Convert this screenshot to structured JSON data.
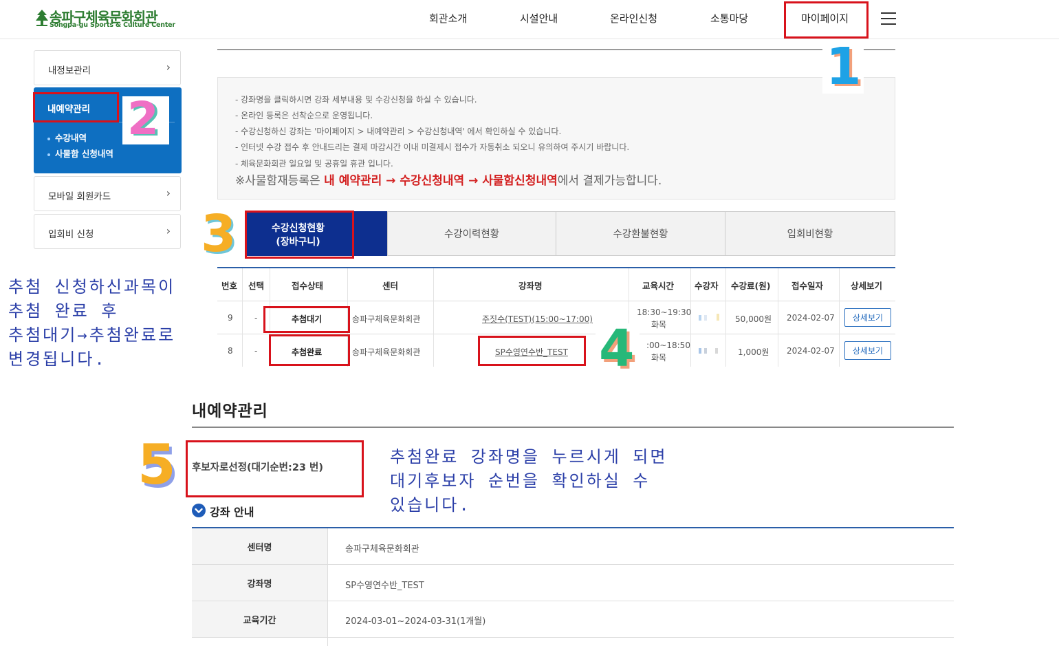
{
  "header": {
    "logo_kr": "송파구체육문화회관",
    "logo_en": "Songpa-gu Sports & Culture Center",
    "nav": [
      "회관소개",
      "시설안내",
      "온라인신청",
      "소통마당",
      "마이페이지"
    ]
  },
  "sidebar": {
    "items": [
      {
        "label": "내정보관리"
      },
      {
        "label": "내예약관리",
        "active": true,
        "subitems": [
          "수강내역",
          "사물함 신청내역"
        ]
      },
      {
        "label": "모바일 회원카드"
      },
      {
        "label": "입회비 신청"
      }
    ]
  },
  "notice": {
    "lines": [
      "- 강좌명을 클릭하시면 강좌 세부내용 및 수강신청을 하실 수 있습니다.",
      "- 온라인 등록은 선착순으로 운영됩니다.",
      "- 수강신청하신 강좌는 '마이페이지 > 내예약관리 > 수강신청내역' 에서 확인하실 수 있습니다.",
      "- 인터넷 수강 접수 후 안내드리는 결제 마감시간 이내 미결제시 접수가 자동취소 되오니 유의하여 주시기 바랍니다.",
      "- 체육문화회관 일요일 및 공휴일 휴관 입니다."
    ],
    "final_prefix": "※사물함재등록은 ",
    "final_red": "내 예약관리 → 수강신청내역 → 사물함신청내역",
    "final_suffix": "에서 결제가능합니다."
  },
  "tabs": {
    "active_line1": "수강신청현황",
    "active_line2": "(장바구니)",
    "others": [
      "수강이력현황",
      "수강환불현황",
      "입회비현황"
    ]
  },
  "table": {
    "headers": [
      "번호",
      "선택",
      "접수상태",
      "센터",
      "강좌명",
      "교육시간",
      "수강자",
      "수강료(원)",
      "접수일자",
      "상세보기"
    ],
    "rows": [
      {
        "no": "9",
        "select": "-",
        "status": "추첨대기",
        "center": "송파구체육문화회관",
        "course": "주짓수(TEST)(15:00~17:00)",
        "time1": "18:30~19:30",
        "time2": "화목",
        "fee": "50,000원",
        "date": "2024-02-07",
        "detail": "상세보기"
      },
      {
        "no": "8",
        "select": "-",
        "status": "추첨완료",
        "center": "송파구체육문화회관",
        "course": "SP수영연수반_TEST",
        "time1": ":00~18:50",
        "time2": "화목",
        "fee": "1,000원",
        "date": "2024-02-07",
        "detail": "상세보기"
      }
    ]
  },
  "annotations": {
    "numbers": [
      "1",
      "2",
      "3",
      "4",
      "5"
    ],
    "left_note": [
      "추첨 신청하신과목이",
      "추첨 완료 후",
      "추첨대기→추첨완료로",
      "변경됩니다."
    ],
    "right_note": [
      "추첨완료 강좌명을 누르시게 되면",
      "대기후보자 순번을 확인하실 수",
      "있습니다."
    ]
  },
  "detail": {
    "section_title": "내예약관리",
    "standby_text": "후보자로선정(대기순번:23 번)",
    "guide_title": "강좌 안내",
    "info": [
      {
        "label": "센터명",
        "value": "송파구체육문화회관"
      },
      {
        "label": "강좌명",
        "value": "SP수영연수반_TEST"
      },
      {
        "label": "교육기간",
        "value": "2024-03-01~2024-03-31(1개월)"
      }
    ]
  },
  "colors": {
    "accent": "#0e6fc1",
    "tab_active": "#0d2f8f",
    "annotation_red": "#d8121b",
    "note_blue": "#2b3fa8"
  }
}
